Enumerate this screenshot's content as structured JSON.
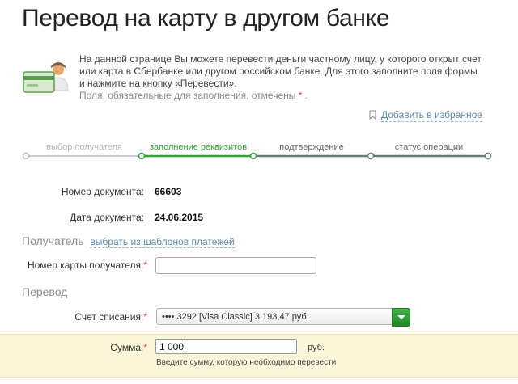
{
  "page": {
    "title": "Перевод на карту в другом банке"
  },
  "intro": {
    "text": "На данной странице Вы можете перевести деньги частному лицу, у которого открыт счет или карта в Сбербанке или другом российском банке. Для этого заполните поля формы и нажмите на кнопку «Перевести».",
    "required_note": "Поля, обязательные для заполнения, отмечены",
    "required_mark": "*",
    "required_end": "."
  },
  "favorites": {
    "label": "Добавить в избранное"
  },
  "steps": [
    {
      "label": "выбор получателя",
      "state": "done"
    },
    {
      "label": "заполнение реквизитов",
      "state": "active"
    },
    {
      "label": "подтверждение",
      "state": "todo"
    },
    {
      "label": "статус операции",
      "state": "todo"
    }
  ],
  "document": {
    "number_label": "Номер документа:",
    "number_value": "66603",
    "date_label": "Дата документа:",
    "date_value": "24.06.2015"
  },
  "recipient": {
    "section_title": "Получатель",
    "templates_link": "выбрать из шаблонов платежей",
    "card_label": "Номер карты получателя:",
    "card_value": ""
  },
  "transfer": {
    "section_title": "Перевод",
    "account_label": "Счет списания:",
    "account_selected": "•••• 3292  [Visa Classic] 3 193,47  руб.",
    "amount_label": "Сумма:",
    "amount_value": "1 000",
    "amount_unit": "руб.",
    "amount_help": "Введите сумму, которую необходимо перевести"
  },
  "colors": {
    "accent_green": "#34a034",
    "link_blue": "#5b8ab2",
    "required_red": "#e0463b",
    "highlight_yellow": "#fbf6d9"
  }
}
